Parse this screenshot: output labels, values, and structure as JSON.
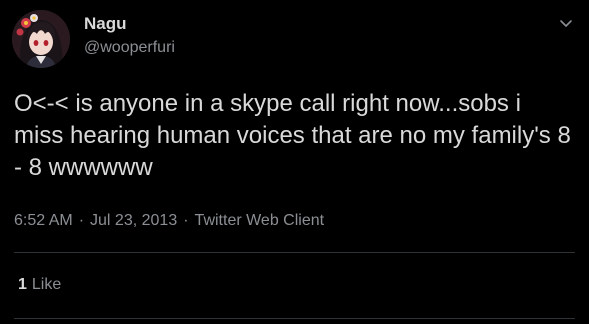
{
  "user": {
    "display_name": "Nagu",
    "handle": "@wooperfuri",
    "avatar_icon": "anime-avatar-icon"
  },
  "tweet": {
    "text": "O<-< is anyone in a skype call right now...sobs i miss hearing human voices that are no my family's 8 - 8 wwwwww",
    "time": "6:52 AM",
    "date": "Jul 23, 2013",
    "separator": "·",
    "client": "Twitter Web Client"
  },
  "stats": {
    "like_count": "1",
    "like_label": "Like"
  },
  "colors": {
    "background": "#000000",
    "text": "#d9d9d9",
    "muted": "#8b8f94",
    "divider": "#2f3336"
  },
  "icons": {
    "menu": "chevron-down-icon"
  }
}
